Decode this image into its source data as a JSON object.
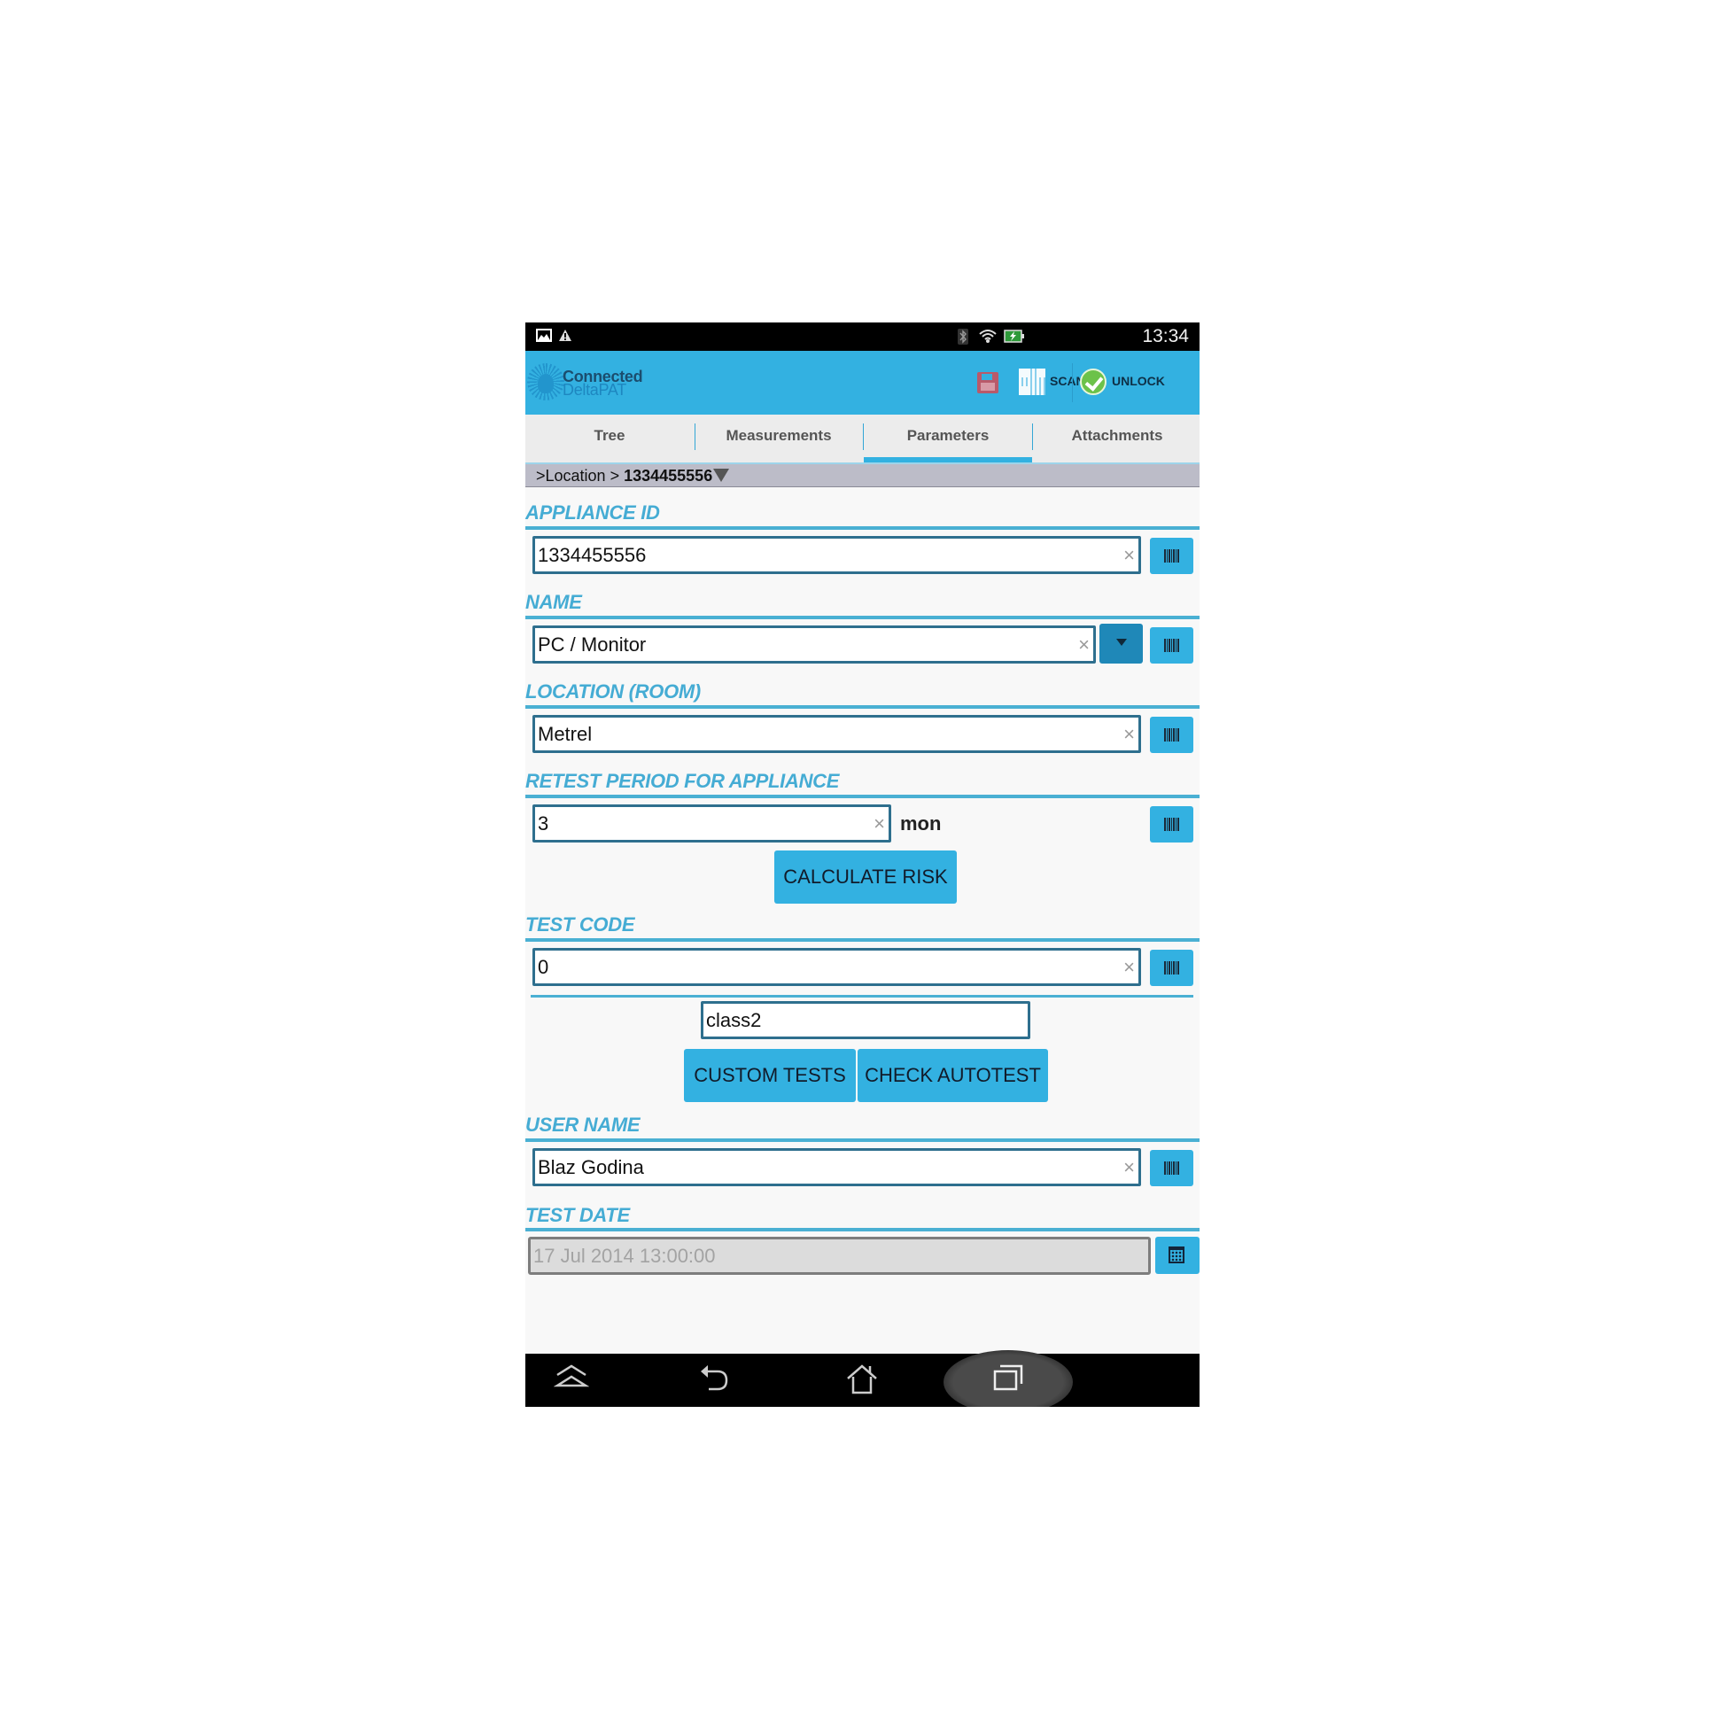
{
  "status_bar": {
    "left_icons": [
      "gallery-notification-icon",
      "warning-notification-icon"
    ],
    "right_icons": [
      "bluetooth-icon",
      "wifi-icon",
      "battery-charging-icon"
    ],
    "time": "13:34"
  },
  "app_bar": {
    "logo_line1": "Connected",
    "logo_line2": "DeltaPAT",
    "save_icon": "floppy-disk-icon",
    "scan_label": "SCAN",
    "scan_icon": "qr-code-icon",
    "unlock_label": "UNLOCK",
    "unlock_icon": "green-check-icon"
  },
  "tabs": [
    {
      "label": "Tree",
      "active": false
    },
    {
      "label": "Measurements",
      "active": false
    },
    {
      "label": "Parameters",
      "active": true
    },
    {
      "label": "Attachments",
      "active": false
    }
  ],
  "breadcrumb": {
    "prefix": ">Location > ",
    "current": "1334455556"
  },
  "colors": {
    "accent": "#33b1e1",
    "section_label": "#45acd4",
    "field_border": "#2e6f8e"
  },
  "form": {
    "appliance_id": {
      "label": "APPLIANCE ID",
      "value": "1334455556"
    },
    "name": {
      "label": "NAME",
      "value": "PC / Monitor"
    },
    "location": {
      "label": "LOCATION (ROOM)",
      "value": "Metrel"
    },
    "retest_period": {
      "label": "RETEST PERIOD FOR APPLIANCE",
      "value": "3",
      "unit": "mon"
    },
    "calculate_risk_label": "CALCULATE RISK",
    "test_code": {
      "label": "TEST CODE",
      "value": "0"
    },
    "class_value": "class2",
    "custom_tests_label": "CUSTOM TESTS",
    "check_autotest_label": "CHECK AUTOTEST",
    "user_name": {
      "label": "USER NAME",
      "value": "Blaz Godina"
    },
    "test_date": {
      "label": "TEST DATE",
      "value": "17 Jul 2014 13:00:00"
    },
    "clear_glyph": "×"
  },
  "nav_bar": {
    "icons": [
      "hide-keyboard-icon",
      "back-icon",
      "home-icon",
      "recent-apps-icon"
    ]
  }
}
